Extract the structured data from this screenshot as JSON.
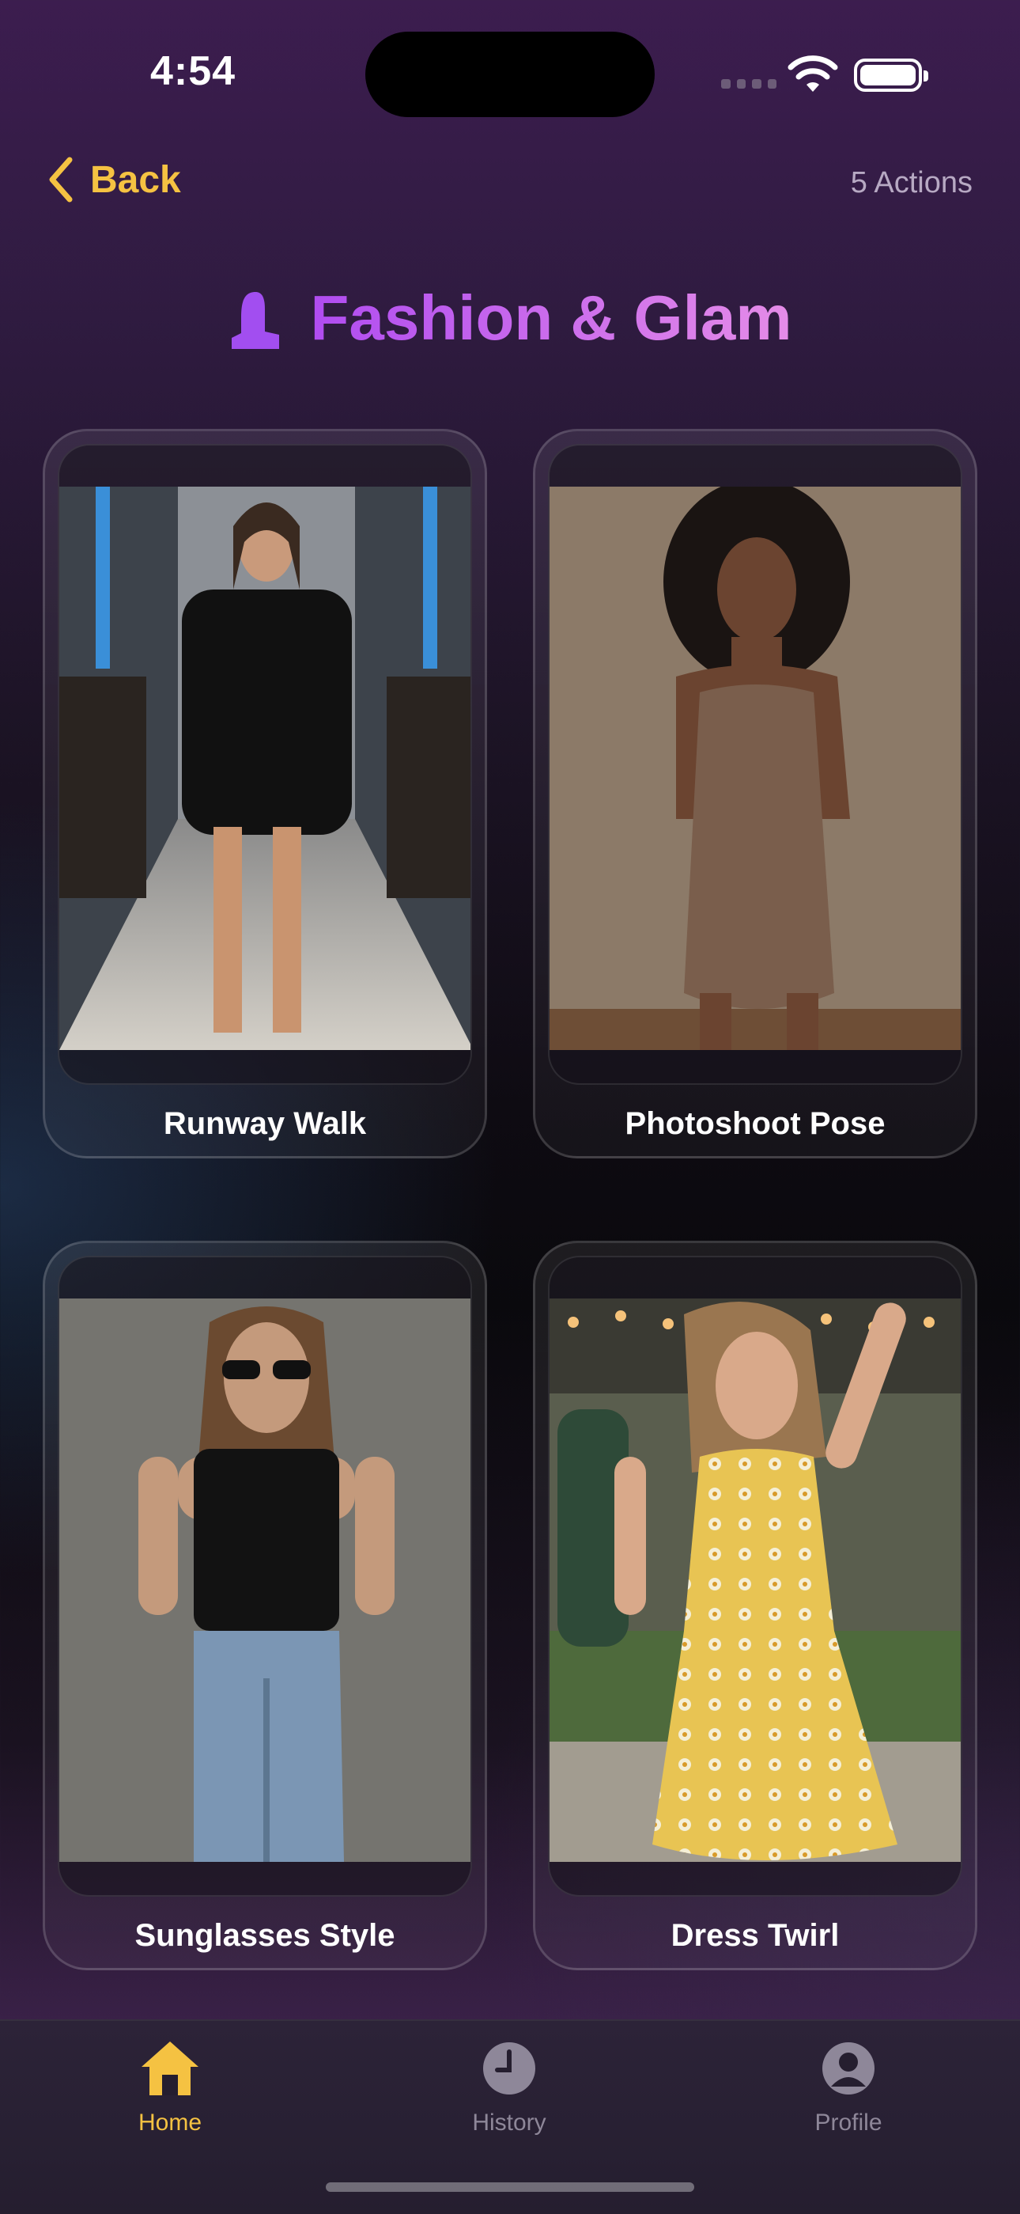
{
  "status_bar": {
    "time": "4:54"
  },
  "header": {
    "back_label": "Back",
    "actions_count": "5 Actions"
  },
  "page": {
    "title": "Fashion & Glam",
    "title_icon": "heel-icon"
  },
  "actions": [
    {
      "label": "Runway Walk",
      "image": "Model in black blazer walking a runway"
    },
    {
      "label": "Photoshoot Pose",
      "image": "Woman in brown dress posing in studio"
    },
    {
      "label": "Sunglasses Style",
      "image": "Woman in sunglasses, black tank and jeans"
    },
    {
      "label": "Dress Twirl",
      "image": "Woman in yellow floral dress dancing outdoors"
    }
  ],
  "tab_bar": {
    "tabs": [
      {
        "label": "Home",
        "icon": "home-icon",
        "active": true
      },
      {
        "label": "History",
        "icon": "clock-icon",
        "active": false
      },
      {
        "label": "Profile",
        "icon": "person-icon",
        "active": false
      }
    ]
  },
  "colors": {
    "accent": "#f5c242",
    "title_start": "#b04cf0",
    "title_end": "#e58ce8",
    "inactive": "#8e8799"
  }
}
